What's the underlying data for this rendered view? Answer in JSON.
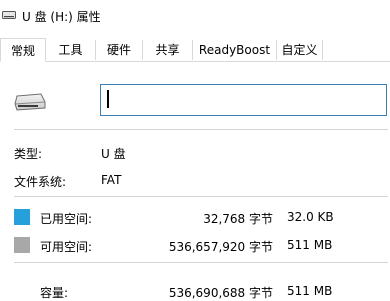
{
  "window": {
    "title": "U 盘 (H:) 属性",
    "icon": "drive-icon"
  },
  "tabs": [
    {
      "label": "常规",
      "active": true
    },
    {
      "label": "工具",
      "active": false
    },
    {
      "label": "硬件",
      "active": false
    },
    {
      "label": "共享",
      "active": false
    },
    {
      "label": "ReadyBoost",
      "active": false
    },
    {
      "label": "自定义",
      "active": false
    }
  ],
  "general": {
    "volume_label_value": "",
    "type_label": "类型:",
    "type_value": "U 盘",
    "fs_label": "文件系统:",
    "fs_value": "FAT",
    "used": {
      "label": "已用空间:",
      "bytes": "32,768 字节",
      "size": "32.0 KB",
      "color": "#26a0da"
    },
    "free": {
      "label": "可用空间:",
      "bytes": "536,657,920 字节",
      "size": "511 MB",
      "color": "#a8a8a8"
    },
    "capacity": {
      "label": "容量:",
      "bytes": "536,690,688 字节",
      "size": "511 MB"
    }
  }
}
